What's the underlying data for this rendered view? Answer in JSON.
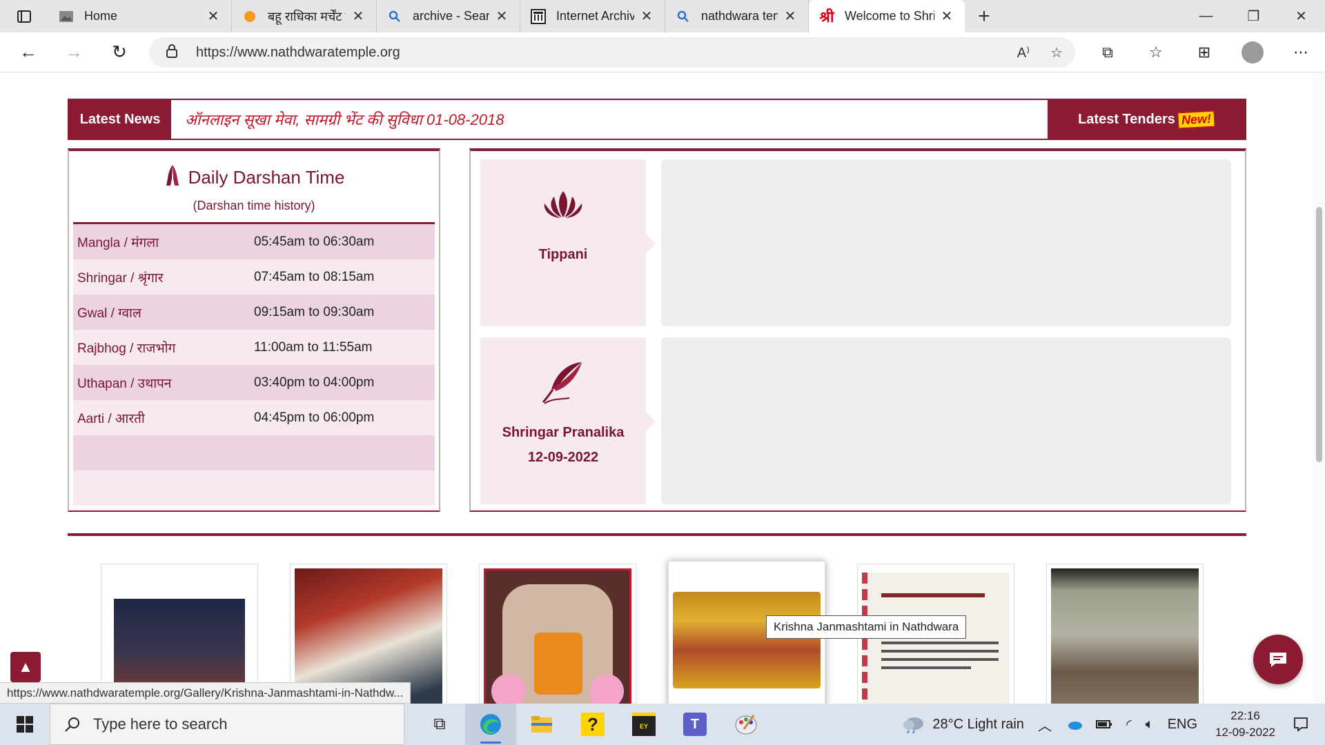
{
  "browser": {
    "tabs": [
      {
        "title": "Home",
        "icon": "page-icon",
        "active": false,
        "width": 266
      },
      {
        "title": "बहू राधिका मर्चेंट के स",
        "icon": "orange-circle-icon",
        "active": false,
        "width": 210
      },
      {
        "title": "archive - Search",
        "icon": "search-icon",
        "active": false,
        "width": 208
      },
      {
        "title": "Internet Archive: Di",
        "icon": "archive-icon",
        "active": false,
        "width": 210
      },
      {
        "title": "nathdwara temple -",
        "icon": "search-icon",
        "active": false,
        "width": 208
      },
      {
        "title": "Welcome to Shrinat",
        "icon": "shri-icon",
        "active": true,
        "width": 226
      }
    ],
    "url": "https://www.nathdwaratemple.org"
  },
  "news": {
    "label": "Latest News",
    "ticker": "ऑनलाइन सूखा मेवा, सामग्री भेंट की सुविधा  01-08-2018",
    "tenders_label": "Latest Tenders",
    "new_badge": "New!"
  },
  "darshan": {
    "title": "Daily Darshan Time",
    "subtitle": "(Darshan time history)",
    "rows": [
      {
        "name": "Mangla / मंगला",
        "time": "05:45am to 06:30am"
      },
      {
        "name": "Shringar / श्रृंगार",
        "time": "07:45am to 08:15am"
      },
      {
        "name": "Gwal / ग्वाल",
        "time": "09:15am to 09:30am"
      },
      {
        "name": "Rajbhog / राजभोग",
        "time": "11:00am to 11:55am"
      },
      {
        "name": "Uthapan / उथापन",
        "time": "03:40pm to 04:00pm"
      },
      {
        "name": "Aarti / आरती",
        "time": "04:45pm to 06:00pm"
      }
    ]
  },
  "cards": {
    "tippani": "Tippani",
    "shringar_title": "Shringar Pranalika",
    "shringar_date": "12-09-2022"
  },
  "gallery": {
    "tooltip": "Krishna Janmashtami in Nathdwara"
  },
  "status_url": "https://www.nathdwaratemple.org/Gallery/Krishna-Janmashtami-in-Nathdw...",
  "taskbar": {
    "search_placeholder": "Type here to search",
    "weather": "28°C  Light rain",
    "lang": "ENG",
    "time": "22:16",
    "date": "12-09-2022"
  },
  "colors": {
    "brand": "#8b1a33",
    "ticker": "#c0182a",
    "row_light": "#f6e9f0",
    "row_dark": "#ecd3e1"
  }
}
